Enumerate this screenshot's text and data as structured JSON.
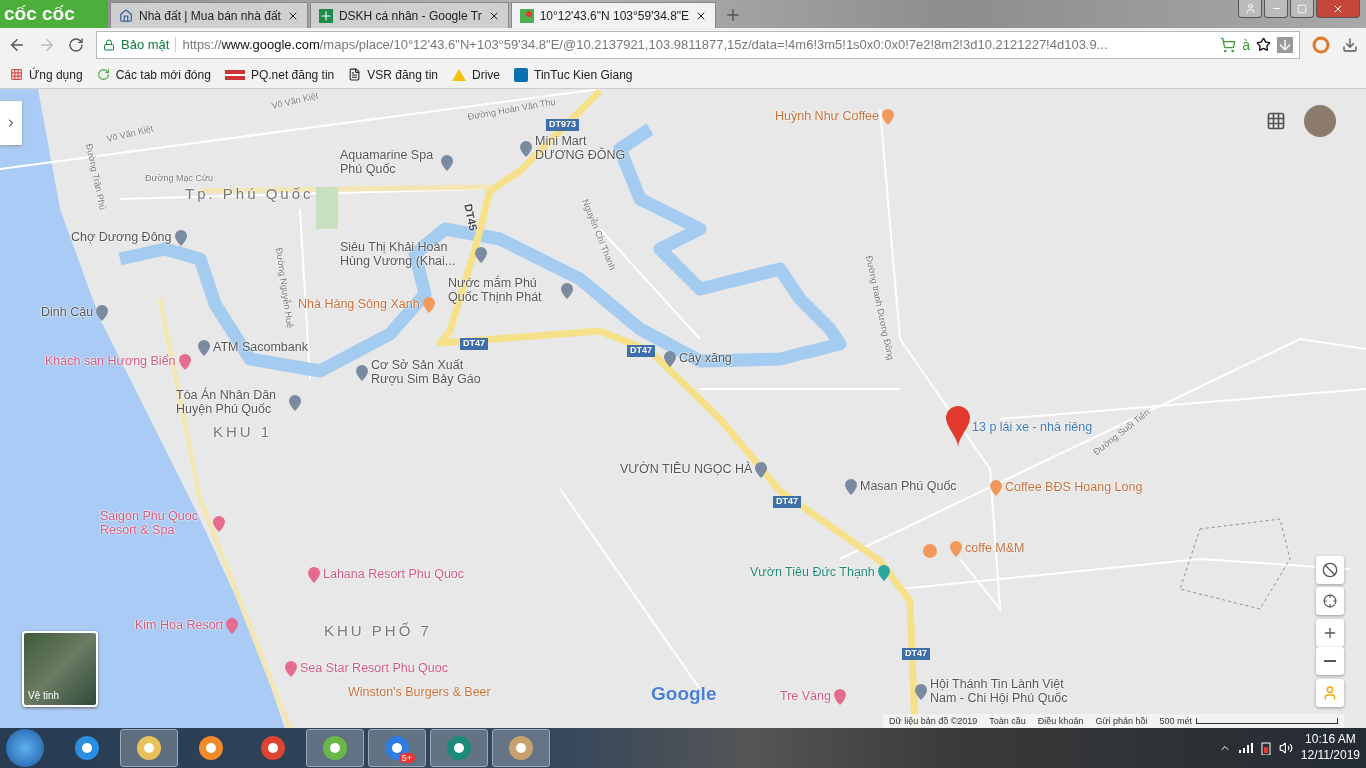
{
  "browser": {
    "logo": "cốc cốc",
    "tabs": [
      {
        "title": "Nhà đất | Mua bán nhà đất",
        "selected": false,
        "kind": "house"
      },
      {
        "title": "DSKH cá nhân - Google Tr",
        "selected": false,
        "kind": "sheet"
      },
      {
        "title": "10°12'43.6\"N 103°59'34.8\"E",
        "selected": true,
        "kind": "maps"
      }
    ],
    "security": "Bảo mật",
    "url": {
      "scheme": "https://",
      "host": "www.google.com",
      "path": "/maps/place/10°12'43.6\"N+103°59'34.8\"E/@10.2137921,103.9811877,15z/data=!4m6!3m5!1s0x0:0x0!7e2!8m2!3d10.2121227!4d103.9..."
    },
    "extension_text": "à",
    "bookmarks": [
      {
        "label": "Ứng dụng",
        "kind": "apps"
      },
      {
        "label": "Các tab mới đóng",
        "kind": "history"
      },
      {
        "label": "PQ.net đăng tin",
        "kind": "flag"
      },
      {
        "label": "VSR đăng tin",
        "kind": "page"
      },
      {
        "label": "Drive",
        "kind": "drive"
      },
      {
        "label": "TinTuc Kien Giang",
        "kind": "sharepoint"
      }
    ]
  },
  "map": {
    "labels": [
      {
        "text": "Võ Văn Kiệt",
        "kind": "street"
      },
      {
        "text": "Võ Văn Kiệt",
        "kind": "street"
      },
      {
        "text": "Đường Hoàn Văn Thụ",
        "kind": "street"
      },
      {
        "text": "DT973",
        "kind": "shield"
      },
      {
        "text": "Huỳnh Như Coffee",
        "kind": "food"
      },
      {
        "text": "Mini Mart DƯƠNG ĐÔNG",
        "kind": "place"
      },
      {
        "text": "Aquamarine Spa Phú Quốc",
        "kind": "place"
      },
      {
        "text": "Đường Trần Phú",
        "kind": "street"
      },
      {
        "text": "Đường Mạc Cửu",
        "kind": "street"
      },
      {
        "text": "Tp. Phú Quốc",
        "kind": "area"
      },
      {
        "text": "DT45",
        "kind": "roadname"
      },
      {
        "text": "Nguyễn Chí Thanh",
        "kind": "street"
      },
      {
        "text": "Đường Nguyễn Huệ",
        "kind": "street"
      },
      {
        "text": "Chợ Dương Đông",
        "kind": "place"
      },
      {
        "text": "Siêu Thị Khải Hoàn Hùng Vương (Khai...",
        "kind": "place"
      },
      {
        "text": "Nước mắm Phú Quốc Thịnh Phát",
        "kind": "place"
      },
      {
        "text": "Nhà Hàng Sông Xanh",
        "kind": "food"
      },
      {
        "text": "Dinh Cậu",
        "kind": "place"
      },
      {
        "text": "ATM Sacombank",
        "kind": "place"
      },
      {
        "text": "DT47",
        "kind": "shield"
      },
      {
        "text": "DT47",
        "kind": "shield"
      },
      {
        "text": "Khách sạn Hương Biển",
        "kind": "hotel"
      },
      {
        "text": "Cây xăng",
        "kind": "place"
      },
      {
        "text": "Cơ Sở Sản Xuất Rượu Sim Bảy Gáo",
        "kind": "place"
      },
      {
        "text": "Tòa Án Nhân Dân Huyện Phú Quốc",
        "kind": "place"
      },
      {
        "text": "KHU 1",
        "kind": "area"
      },
      {
        "text": "Đường tranh Dương Đông",
        "kind": "street"
      },
      {
        "text": "13 p lái xe - nhà riêng",
        "kind": "pin"
      },
      {
        "text": "Đường Suối Tiên",
        "kind": "street"
      },
      {
        "text": "VƯỜN TIÊU NGỌC HÀ",
        "kind": "place"
      },
      {
        "text": "Masan Phú Quốc",
        "kind": "place"
      },
      {
        "text": "Coffee BĐS Hoang Long",
        "kind": "food"
      },
      {
        "text": "DT47",
        "kind": "shield"
      },
      {
        "text": "coffe M&M",
        "kind": "food"
      },
      {
        "text": "Saigon Phu Quoc Resort & Spa",
        "kind": "hotel"
      },
      {
        "text": "Lahana Resort Phu Quoc",
        "kind": "hotel"
      },
      {
        "text": "Vườn Tiêu Đức Thạnh",
        "kind": "park"
      },
      {
        "text": "Kim Hoa Resort",
        "kind": "hotel"
      },
      {
        "text": "KHU PHỐ 7",
        "kind": "area"
      },
      {
        "text": "Sea Star Resort Phu Quoc",
        "kind": "hotel"
      },
      {
        "text": "DT47",
        "kind": "shield"
      },
      {
        "text": "Winston's Burgers & Beer",
        "kind": "food"
      },
      {
        "text": "Tre Vàng",
        "kind": "hotel"
      },
      {
        "text": "Hội Thánh Tin Lành Việt Nam - Chi Hội Phú Quốc",
        "kind": "place"
      }
    ],
    "logo": "Google",
    "satellite_label": "Vệ tinh",
    "footer": [
      "Dữ liệu bản đồ ©2019",
      "Toàn cầu",
      "Điều khoản",
      "Gửi phản hồi"
    ],
    "scale": "500 mét"
  },
  "taskbar": {
    "apps": [
      {
        "kind": "ie",
        "active": false
      },
      {
        "kind": "explorer",
        "active": true
      },
      {
        "kind": "media",
        "active": false
      },
      {
        "kind": "chrome",
        "active": false
      },
      {
        "kind": "coccoc",
        "active": true
      },
      {
        "kind": "zalo",
        "active": true,
        "badge": "5+"
      },
      {
        "kind": "autocad",
        "active": true
      },
      {
        "kind": "paint",
        "active": true
      }
    ],
    "time": "10:16 AM",
    "date": "12/11/2019"
  }
}
